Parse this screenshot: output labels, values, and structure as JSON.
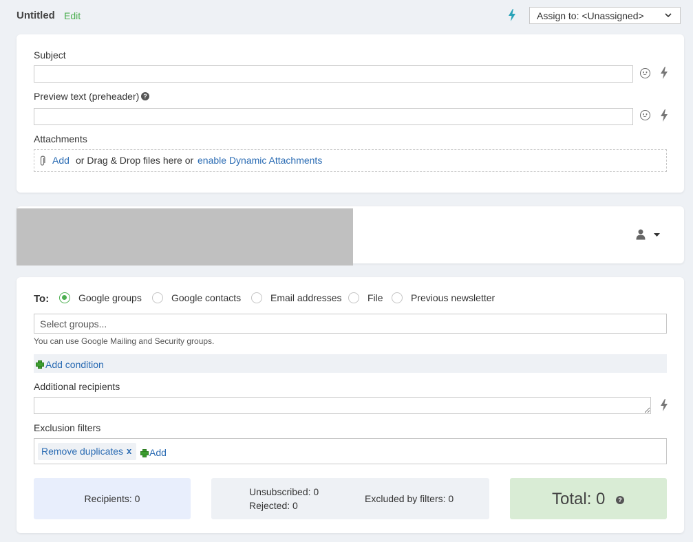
{
  "header": {
    "title": "Untitled",
    "edit_label": "Edit",
    "assign_label": "Assign to: <Unassigned>"
  },
  "compose": {
    "subject_label": "Subject",
    "subject_value": "",
    "preview_label": "Preview text (preheader)",
    "preview_value": "",
    "attachments_label": "Attachments",
    "attach_add": "Add",
    "attach_text": "or Drag & Drop files here or",
    "attach_dynamic": "enable Dynamic Attachments"
  },
  "recipients": {
    "to_label": "To:",
    "sources": [
      {
        "label": "Google groups",
        "selected": true
      },
      {
        "label": "Google contacts",
        "selected": false
      },
      {
        "label": "Email addresses",
        "selected": false
      },
      {
        "label": "File",
        "selected": false
      },
      {
        "label": "Previous newsletter",
        "selected": false
      }
    ],
    "groups_placeholder": "Select groups...",
    "groups_hint": "You can use Google Mailing and Security groups.",
    "add_condition": "Add condition",
    "additional_label": "Additional recipients",
    "additional_value": "",
    "exclusion_label": "Exclusion filters",
    "exclusion_tag": "Remove duplicates",
    "exclusion_tag_remove": "x",
    "exclusion_add": "Add"
  },
  "summary": {
    "recipients": "Recipients: 0",
    "unsubscribed": "Unsubscribed: 0",
    "rejected": "Rejected: 0",
    "excluded": "Excluded by filters: 0",
    "total": "Total: 0"
  },
  "colors": {
    "accent_green": "#4caf50",
    "link_blue": "#2a6bb3",
    "recipients_bg": "#e8eefc",
    "total_bg": "#d9ecd5"
  }
}
